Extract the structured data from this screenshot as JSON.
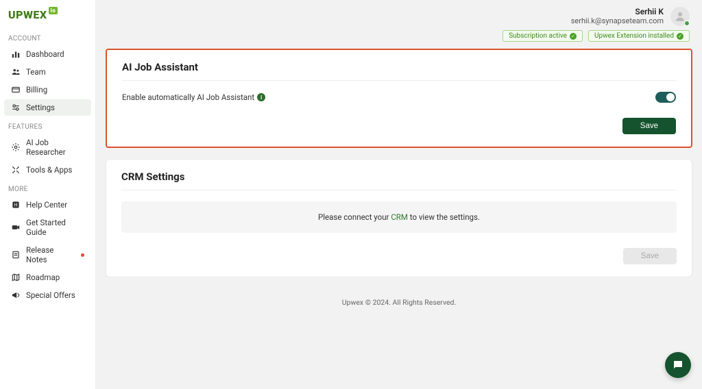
{
  "brand": {
    "name": "UPWEX",
    "badge": "io"
  },
  "sidebar": {
    "sections": [
      {
        "label": "ACCOUNT",
        "items": [
          {
            "icon": "dashboard",
            "label": "Dashboard"
          },
          {
            "icon": "team",
            "label": "Team"
          },
          {
            "icon": "billing",
            "label": "Billing"
          },
          {
            "icon": "settings",
            "label": "Settings",
            "active": true
          }
        ]
      },
      {
        "label": "FEATURES",
        "items": [
          {
            "icon": "ai",
            "label": "AI Job Researcher"
          },
          {
            "icon": "tools",
            "label": "Tools & Apps"
          }
        ]
      },
      {
        "label": "MORE",
        "items": [
          {
            "icon": "help",
            "label": "Help Center"
          },
          {
            "icon": "video",
            "label": "Get Started Guide"
          },
          {
            "icon": "notes",
            "label": "Release Notes",
            "dot": true
          },
          {
            "icon": "roadmap",
            "label": "Roadmap"
          },
          {
            "icon": "offers",
            "label": "Special Offers"
          }
        ]
      }
    ]
  },
  "user": {
    "name": "Serhii K",
    "email": "serhii.k@synapseteam.com"
  },
  "badges": {
    "subscription": "Subscription active",
    "extension": "Upwex Extension installed"
  },
  "cards": {
    "aiAssistant": {
      "title": "AI Job Assistant",
      "toggleLabel": "Enable automatically AI Job Assistant",
      "saveLabel": "Save"
    },
    "crm": {
      "title": "CRM Settings",
      "noticePrefix": "Please connect your ",
      "noticeLink": "CRM",
      "noticeSuffix": " to view the settings.",
      "saveLabel": "Save"
    }
  },
  "footer": "Upwex © 2024. All Rights Reserved."
}
